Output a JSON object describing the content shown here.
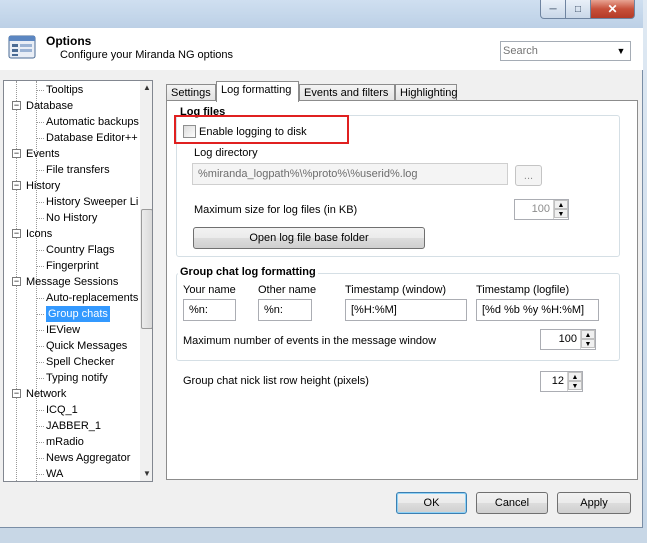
{
  "window": {
    "title_bar_text": "",
    "min_glyph": "─",
    "max_glyph": "□",
    "close_glyph": "✕"
  },
  "header": {
    "title": "Options",
    "subtitle": "Configure your Miranda NG options",
    "search_placeholder": "Search",
    "search_dropdown_glyph": "▼"
  },
  "tree": {
    "items": [
      {
        "label": "Tooltips",
        "level": 1
      },
      {
        "label": "Database",
        "level": 0,
        "expander": "−"
      },
      {
        "label": "Automatic backups",
        "level": 1
      },
      {
        "label": "Database Editor++",
        "level": 1
      },
      {
        "label": "Events",
        "level": 0,
        "expander": "−"
      },
      {
        "label": "File transfers",
        "level": 1
      },
      {
        "label": "History",
        "level": 0,
        "expander": "−"
      },
      {
        "label": "History Sweeper Li",
        "level": 1
      },
      {
        "label": "No History",
        "level": 1
      },
      {
        "label": "Icons",
        "level": 0,
        "expander": "−"
      },
      {
        "label": "Country Flags",
        "level": 1
      },
      {
        "label": "Fingerprint",
        "level": 1
      },
      {
        "label": "Message Sessions",
        "level": 0,
        "expander": "−"
      },
      {
        "label": "Auto-replacements",
        "level": 1
      },
      {
        "label": "Group chats",
        "level": 1,
        "selected": true
      },
      {
        "label": "IEView",
        "level": 1
      },
      {
        "label": "Quick Messages",
        "level": 1
      },
      {
        "label": "Spell Checker",
        "level": 1
      },
      {
        "label": "Typing notify",
        "level": 1
      },
      {
        "label": "Network",
        "level": 0,
        "expander": "−"
      },
      {
        "label": "ICQ_1",
        "level": 1
      },
      {
        "label": "JABBER_1",
        "level": 1
      },
      {
        "label": "mRadio",
        "level": 1
      },
      {
        "label": "News Aggregator",
        "level": 1
      },
      {
        "label": "WA",
        "level": 1
      }
    ],
    "scroll_up_glyph": "▲",
    "scroll_down_glyph": "▼"
  },
  "tabs": [
    {
      "label": "Settings"
    },
    {
      "label": "Log formatting",
      "active": true
    },
    {
      "label": "Events and filters"
    },
    {
      "label": "Highlighting"
    }
  ],
  "log_files": {
    "group_label": "Log files",
    "enable_logging_label": "Enable logging to disk",
    "enable_logging_checked": false,
    "log_directory_label": "Log directory",
    "log_directory_value": "%miranda_logpath%\\%proto%\\%userid%.log",
    "browse_label": "...",
    "max_size_label": "Maximum size for log files (in KB)",
    "max_size_value": "100",
    "open_folder_label": "Open log file base folder"
  },
  "group_chat": {
    "group_label": "Group chat log formatting",
    "your_name_label": "Your name",
    "your_name_value": "%n:",
    "other_name_label": "Other name",
    "other_name_value": "%n:",
    "timestamp_window_label": "Timestamp (window)",
    "timestamp_window_value": "[%H:%M]",
    "timestamp_logfile_label": "Timestamp (logfile)",
    "timestamp_logfile_value": "[%d %b %y %H:%M]",
    "max_events_label": "Maximum number of events in the message window",
    "max_events_value": "100"
  },
  "nick_list": {
    "label": "Group chat nick list row height (pixels)",
    "value": "12"
  },
  "spin_up_glyph": "▲",
  "spin_down_glyph": "▼",
  "footer": {
    "ok_label": "OK",
    "cancel_label": "Cancel",
    "apply_label": "Apply"
  },
  "colors": {
    "selection": "#3399ff",
    "highlight_box": "#e02020",
    "titlebar": "#bcd0e6",
    "close_button": "#c7503a"
  }
}
